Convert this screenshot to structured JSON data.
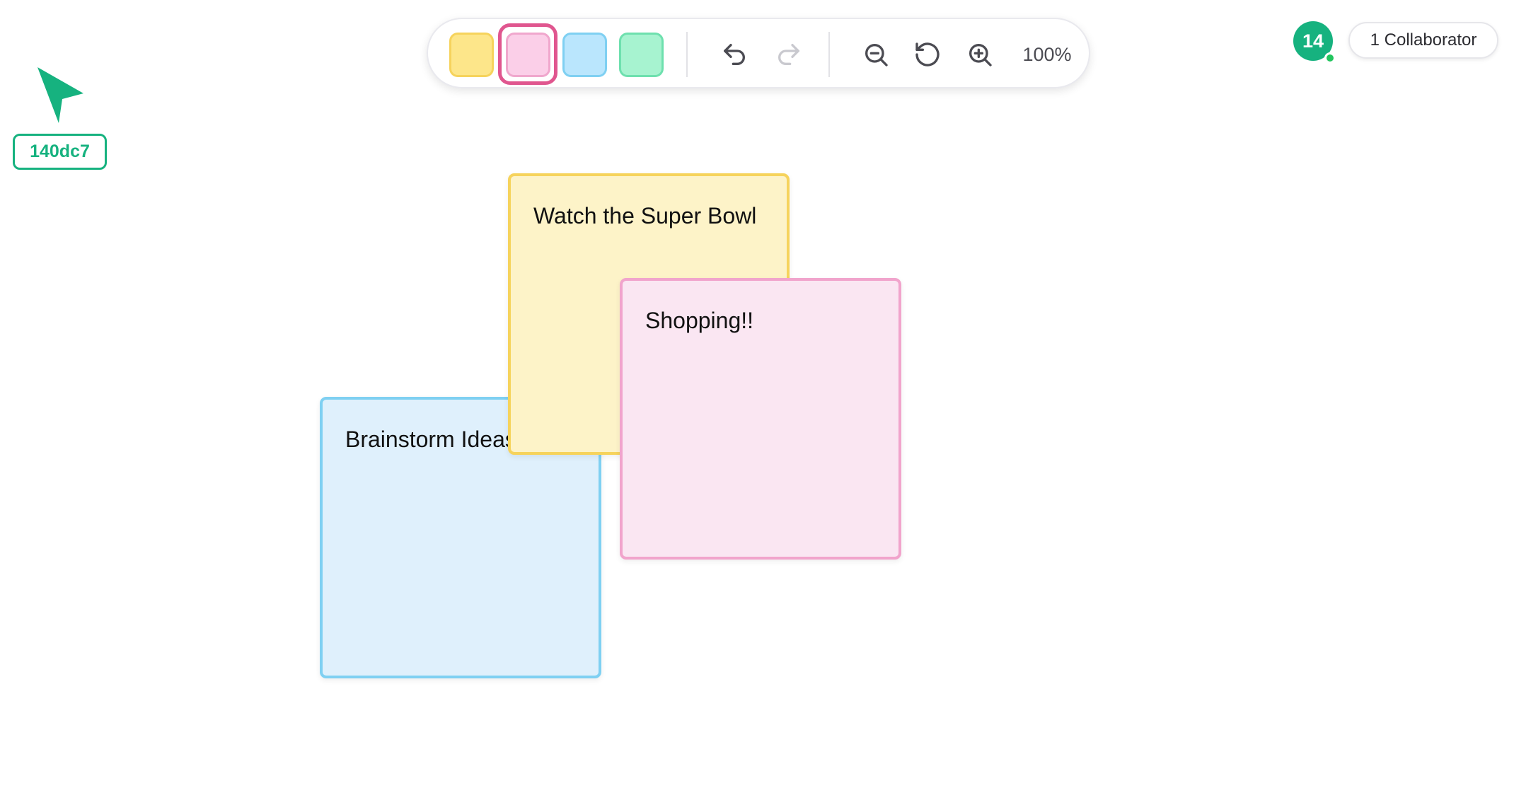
{
  "toolbar": {
    "swatches": [
      {
        "name": "yellow",
        "fill": "#fde68a",
        "border": "#f6d35c"
      },
      {
        "name": "pink",
        "fill": "#fbcfe8",
        "border": "#f0a7cd",
        "selected": true
      },
      {
        "name": "blue",
        "fill": "#bae6fd",
        "border": "#7fd0f2"
      },
      {
        "name": "green",
        "fill": "#a7f3d0",
        "border": "#6ee0ae"
      }
    ],
    "undo_icon": "undo-icon",
    "redo_icon": "redo-icon",
    "zoom_out_icon": "zoom-out-icon",
    "reset_zoom_icon": "reset-zoom-icon",
    "zoom_in_icon": "zoom-in-icon",
    "zoom_level": "100%"
  },
  "collaborators": {
    "avatar_label": "14",
    "count_label": "1 Collaborator",
    "presence_color": "#22c55e",
    "avatar_color": "#16b27f"
  },
  "remote_cursor": {
    "label": "140dc7",
    "color": "#16b27f"
  },
  "notes": [
    {
      "text": "Brainstorm Ideas",
      "color": "blue"
    },
    {
      "text": "Watch the Super Bowl",
      "color": "yellow"
    },
    {
      "text": "Shopping!!",
      "color": "pink"
    }
  ]
}
